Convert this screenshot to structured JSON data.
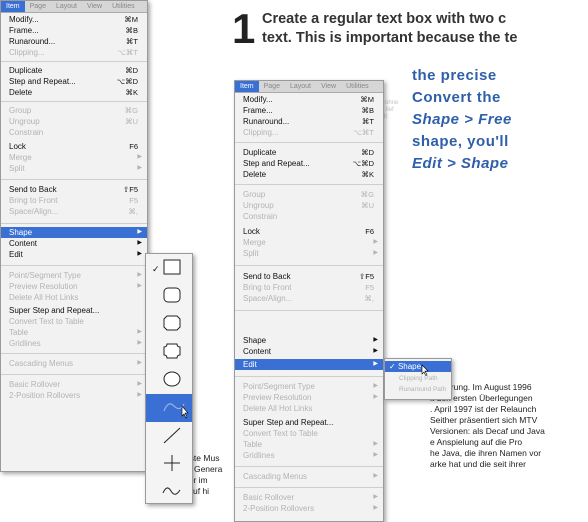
{
  "instruction": {
    "step_number": "1",
    "headline_line1": "Create a regular text box with two c",
    "headline_line2": "text. This is important because the te",
    "body_line1": "the precise",
    "body_line2": "Convert the",
    "body_line3": "Shape > Free",
    "body_line4": "shape, you'll",
    "body_line5": "Edit > Shape"
  },
  "menubar": {
    "items": [
      "Item",
      "Page",
      "Layout",
      "View",
      "Utilities"
    ]
  },
  "item_menu": {
    "modify": "Modify...",
    "modify_sc": "⌘M",
    "frame": "Frame...",
    "frame_sc": "⌘B",
    "runaround": "Runaround...",
    "runaround_sc": "⌘T",
    "clipping": "Clipping...",
    "clipping_sc": "⌥⌘T",
    "duplicate": "Duplicate",
    "duplicate_sc": "⌘D",
    "step_repeat": "Step and Repeat...",
    "step_repeat_sc": "⌥⌘D",
    "delete": "Delete",
    "delete_sc": "⌘K",
    "group": "Group",
    "group_sc": "⌘G",
    "ungroup": "Ungroup",
    "ungroup_sc": "⌘U",
    "constrain": "Constrain",
    "lock": "Lock",
    "lock_sc": "F6",
    "merge": "Merge",
    "split": "Split",
    "send_back": "Send to Back",
    "send_back_sc": "⇧F5",
    "bring_front": "Bring to Front",
    "bring_front_sc": "F5",
    "space_align": "Space/Align...",
    "space_align_sc": "⌘,",
    "shape": "Shape",
    "content": "Content",
    "edit": "Edit",
    "point_seg": "Point/Segment Type",
    "preview_res": "Preview Resolution",
    "delete_all_hyph": "Delete All Hot Links",
    "super_step": "Super Step and Repeat...",
    "convert_table": "Convert Text to Table",
    "table": "Table",
    "gridlines": "Gridlines",
    "cascading": "Cascading Menus",
    "rollover": "Basic Rollover",
    "two_position": "2-Position Rollovers"
  },
  "edit_submenu": {
    "shape": "Shape",
    "clipping_path": "Clipping Path",
    "runaround_path": "Runaround Path"
  },
  "article": {
    "left_lines": [
      "vor  s",
      "der sta",
      ", hielte",
      "greich a",
      "erfolgreichste Mus",
      "eine ganze Genera",
      "hat MTV vor im",
      "deutet darauf hi"
    ],
    "right_lines": [
      "kturierung. Im August 1996",
      "it den ersten Überlegungen",
      ". April 1997 ist der Relaunch",
      "Seither präsentiert sich MTV",
      "Versionen: als Decaf und Java",
      "e Anspielung auf die Pro",
      "he Java, die ihren Namen vor",
      "arke hat und die seit ihrer"
    ]
  },
  "colors": {
    "menu_highlight": "#3a6fd4",
    "headline_blue": "#2f5faa"
  },
  "shape_icons": [
    "rectangle-shape-icon",
    "rounded-rectangle-shape-icon",
    "beveled-corner-shape-icon",
    "concave-corner-shape-icon",
    "oval-shape-icon",
    "bezier-shape-icon",
    "line-icon",
    "orthogonal-line-icon",
    "bezier-line-icon"
  ]
}
